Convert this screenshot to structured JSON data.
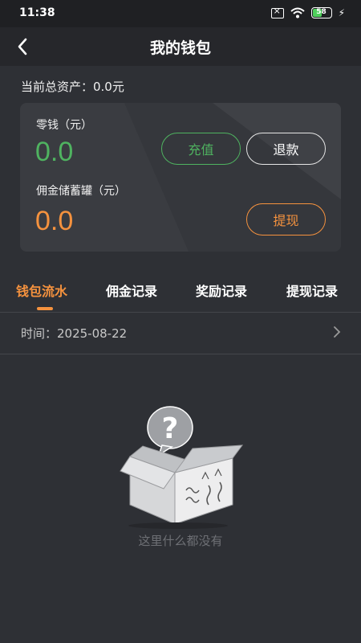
{
  "status_bar": {
    "time": "11:38",
    "battery_level": "58",
    "battery_percent": 58
  },
  "nav": {
    "title": "我的钱包"
  },
  "summary": {
    "total_assets_text": "当前总资产：0.0元"
  },
  "wallet": {
    "change_label": "零钱（元）",
    "change_value": "0.0",
    "commission_label": "佣金储蓄罐（元）",
    "commission_value": "0.0",
    "recharge_label": "充值",
    "refund_label": "退款",
    "withdraw_label": "提现"
  },
  "tabs": [
    {
      "label": "钱包流水",
      "active": true
    },
    {
      "label": "佣金记录",
      "active": false
    },
    {
      "label": "奖励记录",
      "active": false
    },
    {
      "label": "提现记录",
      "active": false
    }
  ],
  "filter": {
    "date_text": "时间：2025-08-22"
  },
  "empty_state": {
    "message": "这里什么都没有"
  },
  "colors": {
    "background": "#2e3035",
    "card": "#3a3c41",
    "green": "#4fb360",
    "orange": "#f5923e",
    "nav": "#26272b"
  }
}
